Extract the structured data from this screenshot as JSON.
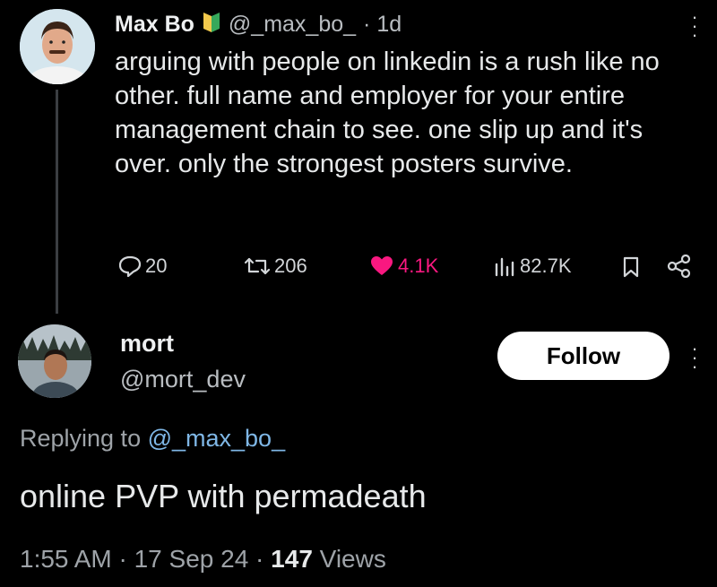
{
  "tweet": {
    "author_name": "Max Bo",
    "handle": "@_max_bo_",
    "time": "· 1d",
    "text": "arguing with people on linkedin is a rush like no other. full name and employer for your entire management chain to see. one slip up and it's over. only the strongest posters survive.",
    "actions": {
      "replies": "20",
      "reposts": "206",
      "likes": "4.1K",
      "views": "82.7K"
    }
  },
  "reply": {
    "author_name": "mort",
    "handle": "@mort_dev",
    "follow_label": "Follow",
    "replying_to_prefix": "Replying to ",
    "replying_to_handle": "@_max_bo_",
    "text": "online PVP with permadeath",
    "time_date": "1:55 AM · 17 Sep 24 · ",
    "views_count": "147",
    "views_label": " Views"
  },
  "colors": {
    "like_pink": "#f91880",
    "mention_blue": "#7fb7e6",
    "badge_yellow": "#f2c94c",
    "badge_green": "#37a85b"
  }
}
